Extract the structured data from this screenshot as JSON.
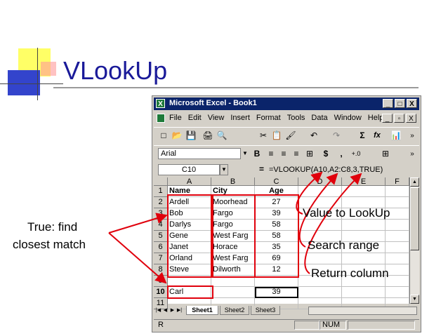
{
  "slide": {
    "title": "VLookUp",
    "accent_colors": {
      "yellow": "#ffff66",
      "blue": "#3344cc",
      "title_text": "#1a1a99",
      "annotation": "#e0000c"
    }
  },
  "excel": {
    "window_title": "Microsoft Excel - Book1",
    "window_buttons": [
      "_",
      "□",
      "X"
    ],
    "menu": [
      "File",
      "Edit",
      "View",
      "Insert",
      "Format",
      "Tools",
      "Data",
      "Window",
      "Help"
    ],
    "mdi_buttons": [
      "_",
      "▫",
      "X"
    ],
    "toolbar_standard": [
      "□",
      "📂",
      "💾",
      "🖨",
      "🔍",
      "✂",
      "📋",
      "🖌",
      "↶",
      "↷",
      "Σ",
      "fx",
      "📊",
      "»"
    ],
    "font_name": "Arial",
    "toolbar_format": [
      "B",
      "≡",
      "≡",
      "≡",
      "⊞",
      "$",
      ",",
      "+.0",
      "⊞",
      "»"
    ],
    "name_box": "C10",
    "formula": "=VLOOKUP(A10,A2:C8,3,TRUE)",
    "columns": [
      "A",
      "B",
      "C",
      "D",
      "E",
      "F"
    ],
    "rows": [
      "1",
      "2",
      "3",
      "4",
      "5",
      "6",
      "7",
      "8",
      "9",
      "10",
      "11"
    ],
    "cells": [
      [
        "Name",
        "City",
        "Age"
      ],
      [
        "Ardell",
        "Moorhead",
        "27"
      ],
      [
        "Bob",
        "Fargo",
        "39"
      ],
      [
        "Darlys",
        "Fargo",
        "58"
      ],
      [
        "Gene",
        "West Farg",
        "58"
      ],
      [
        "Janet",
        "Horace",
        "35"
      ],
      [
        "Orland",
        "West Farg",
        "69"
      ],
      [
        "Steve",
        "Dilworth",
        "12"
      ],
      [
        "",
        "",
        ""
      ],
      [
        "Carl",
        "",
        "39"
      ],
      [
        "",
        "",
        ""
      ]
    ],
    "sheet_tabs": [
      "Sheet1",
      "Sheet2",
      "Sheet3"
    ],
    "status_ready": "R",
    "status_num": "NUM"
  },
  "annotations": {
    "left_note": [
      "True: find",
      "closest match"
    ],
    "value_lookup": "Value to LookUp",
    "search_range": "Search range",
    "return_column": "Return column"
  }
}
